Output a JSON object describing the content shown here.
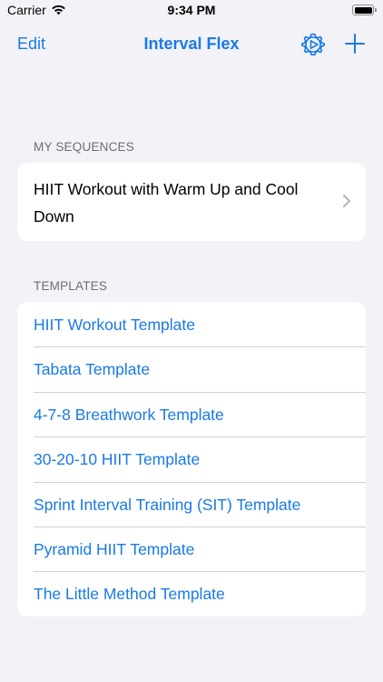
{
  "status_bar": {
    "carrier": "Carrier",
    "time": "9:34 PM"
  },
  "nav": {
    "edit_label": "Edit",
    "title": "Interval Flex",
    "settings_icon": "gear-play-icon",
    "add_icon": "plus-icon"
  },
  "my_sequences": {
    "header": "MY SEQUENCES",
    "items": [
      {
        "label": "HIIT Workout with Warm Up and Cool Down"
      }
    ]
  },
  "templates": {
    "header": "TEMPLATES",
    "items": [
      {
        "label": "HIIT Workout Template"
      },
      {
        "label": "Tabata Template"
      },
      {
        "label": "4-7-8 Breathwork Template"
      },
      {
        "label": "30-20-10 HIIT Template"
      },
      {
        "label": "Sprint Interval Training (SIT) Template"
      },
      {
        "label": "Pyramid HIIT Template"
      },
      {
        "label": "The Little Method Template"
      }
    ]
  },
  "colors": {
    "accent": "#1a7ae6",
    "background": "#f2f2f7",
    "card": "#ffffff",
    "section_header": "#6d6d72"
  }
}
